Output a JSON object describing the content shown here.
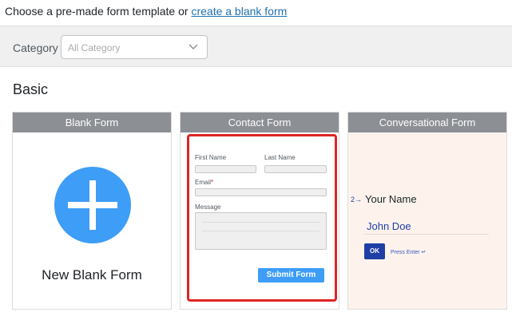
{
  "intro": {
    "text": "Choose a pre-made form template or",
    "link_label": "create a blank form"
  },
  "filter": {
    "label": "Category",
    "select_value": "All Category",
    "chevron_icon": "chevron-down-icon"
  },
  "section": {
    "title": "Basic"
  },
  "templates": [
    {
      "header": "Blank Form",
      "label": "New Blank Form",
      "icon": "plus-circle-icon",
      "icon_color": "#3d9df7"
    },
    {
      "header": "Contact Form",
      "fields": {
        "first_name": "First Name",
        "last_name": "Last Name",
        "email": "Email",
        "email_required_mark": "*",
        "message": "Message"
      },
      "submit_label": "Submit Form",
      "highlight_color": "#e02424"
    },
    {
      "header": "Conversational Form",
      "question_number": "2→",
      "question": "Your Name",
      "answer": "John Doe",
      "ok_label": "OK",
      "hint": "Press Enter ↵"
    }
  ],
  "colors": {
    "accent": "#3d9df7",
    "header_bg": "#8c8f94",
    "link": "#2271b1"
  }
}
